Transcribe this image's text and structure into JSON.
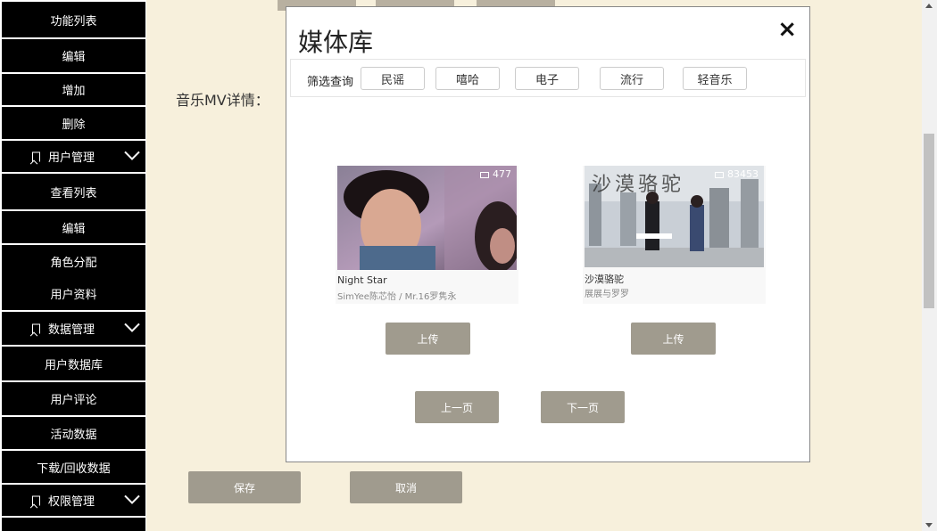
{
  "sidebar": {
    "items": [
      {
        "label": "功能列表",
        "type": "item"
      },
      {
        "label": "编辑",
        "type": "item"
      },
      {
        "label": "增加",
        "type": "item"
      },
      {
        "label": "删除",
        "type": "item"
      },
      {
        "label": "用户管理",
        "type": "group"
      },
      {
        "label": "查看列表",
        "type": "item"
      },
      {
        "label": "编辑",
        "type": "item"
      },
      {
        "label": "角色分配",
        "type": "item"
      },
      {
        "label": "用户资料",
        "type": "item"
      },
      {
        "label": "数据管理",
        "type": "group"
      },
      {
        "label": "用户数据库",
        "type": "item"
      },
      {
        "label": "用户评论",
        "type": "item"
      },
      {
        "label": "活动数据",
        "type": "item"
      },
      {
        "label": "下载/回收数据",
        "type": "item"
      },
      {
        "label": "权限管理",
        "type": "group"
      }
    ]
  },
  "main": {
    "detail_label": "音乐MV详情：",
    "save_label": "保存",
    "cancel_label": "取消"
  },
  "modal": {
    "title": "媒体库",
    "close_icon": "×",
    "filter_label": "筛选查询",
    "filters": [
      "民谣",
      "嘻哈",
      "电子",
      "流行",
      "轻音乐"
    ],
    "videos": [
      {
        "title": "Night Star",
        "artist": "SimYee陈芯怡 / Mr.16罗隽永",
        "views": "477",
        "upload_label": "上传"
      },
      {
        "title": "沙漠骆驼",
        "artist": "展展与罗罗",
        "views": "83453",
        "upload_label": "上传",
        "overlay_text": "沙漠骆驼"
      }
    ],
    "prev_label": "上一页",
    "next_label": "下一页"
  },
  "colors": {
    "page_bg": "#f7f0dc",
    "sidebar_bg": "#000000",
    "button_bg": "#a09b8e"
  }
}
